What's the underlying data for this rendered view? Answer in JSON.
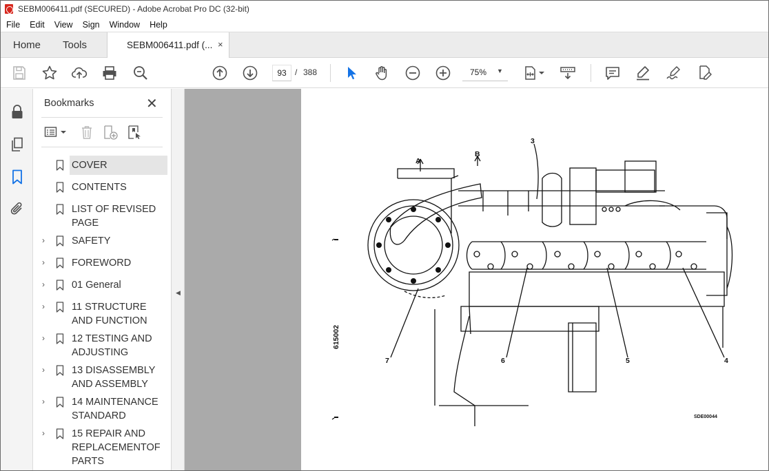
{
  "window": {
    "title": "SEBM006411.pdf (SECURED) - Adobe Acrobat Pro DC (32-bit)"
  },
  "menu": [
    "File",
    "Edit",
    "View",
    "Sign",
    "Window",
    "Help"
  ],
  "tabs": {
    "home": "Home",
    "tools": "Tools",
    "document": "SEBM006411.pdf (...",
    "close_glyph": "×"
  },
  "toolbar": {
    "current_page": "93",
    "page_separator": "/",
    "total_pages": "388",
    "zoom": "75%",
    "zoom_caret": "▼"
  },
  "bookmarks": {
    "title": "Bookmarks",
    "close_glyph": "✕",
    "items": [
      {
        "label": "COVER",
        "expandable": false,
        "selected": true
      },
      {
        "label": "CONTENTS",
        "expandable": false
      },
      {
        "label": "LIST OF REVISED PAGE",
        "expandable": false
      },
      {
        "label": "SAFETY",
        "expandable": true
      },
      {
        "label": "FOREWORD",
        "expandable": true
      },
      {
        "label": "01 General",
        "expandable": true
      },
      {
        "label": "11 STRUCTURE AND FUNCTION",
        "expandable": true
      },
      {
        "label": "12 TESTING AND ADJUSTING",
        "expandable": true
      },
      {
        "label": "13 DISASSEMBLY AND ASSEMBLY",
        "expandable": true
      },
      {
        "label": "14 MAINTENANCE STANDARD",
        "expandable": true
      },
      {
        "label": "15 REPAIR AND REPLACEMENTOF PARTS",
        "expandable": true
      }
    ],
    "expander_glyph": "›"
  },
  "splitter": {
    "grip_glyph": "◀"
  },
  "document": {
    "callouts": {
      "a": "A",
      "b": "B",
      "n3": "3",
      "n4": "4",
      "n5": "5",
      "n6": "6",
      "n7": "7",
      "side_code": "615002",
      "ref_code": "SDE00044"
    }
  },
  "colors": {
    "accent_blue": "#1473e6",
    "icon_gray": "#505050",
    "doc_background": "#aaaaaa",
    "acrobat_red": "#d7281e"
  }
}
